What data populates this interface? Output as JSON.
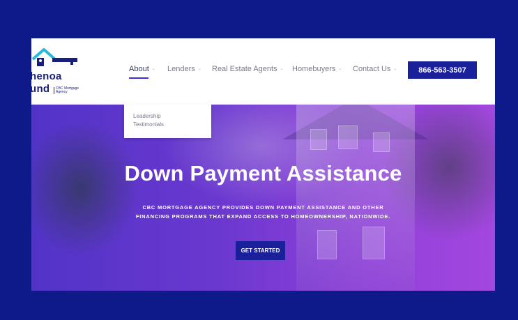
{
  "brand": {
    "logo_line1": "henoa",
    "logo_line2": "und",
    "logo_sub": "CBC Mortgage Agency",
    "accent": "#1a1f9a",
    "key_color": "#2ab7d8"
  },
  "nav": {
    "items": [
      {
        "label": "About",
        "active": true
      },
      {
        "label": "Lenders"
      },
      {
        "label": "Real Estate Agents"
      },
      {
        "label": "Homebuyers"
      },
      {
        "label": "Contact Us"
      }
    ],
    "caret": "⌄",
    "phone": "866-563-3507"
  },
  "dropdown": {
    "items": [
      "Leadership",
      "Testimonials"
    ]
  },
  "hero": {
    "title": "Down Payment Assistance",
    "subtitle_line1": "CBC MORTGAGE AGENCY PROVIDES DOWN PAYMENT ASSISTANCE AND OTHER",
    "subtitle_line2": "FINANCING PROGRAMS THAT EXPAND ACCESS TO HOMEOWNERSHIP, NATIONWIDE.",
    "cta": "GET STARTED"
  },
  "colors": {
    "page_background": "#0f1a8a",
    "hero_gradient_start": "#5233c8",
    "hero_gradient_end": "#a347df"
  }
}
